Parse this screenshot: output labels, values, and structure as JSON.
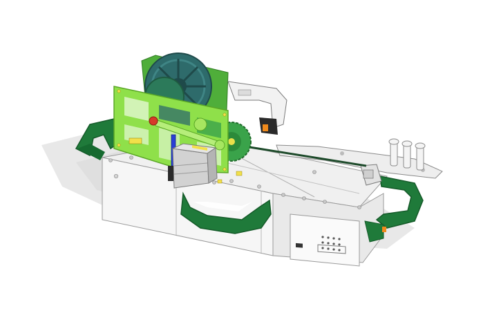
{
  "scene": {
    "subject": "3d-printed-machine-assembly",
    "colors": {
      "background": "#ffffff",
      "shadow": "#e4e4e4",
      "housing": "#f2f2f2",
      "housing_edge": "#9a9a9a",
      "handle": "#1f7a3a",
      "handle_dark": "#155a29",
      "frame_green": "#8fe04a",
      "frame_green_dark": "#5aa626",
      "gear_teal": "#2e6b6b",
      "gear_green": "#3aa34a",
      "motor": "#cfcfcf",
      "motor_dark": "#8a8a8a",
      "bracket": "#e8e8e8",
      "accent_orange": "#f08a1c",
      "accent_red": "#d63a2a",
      "accent_blue": "#2a3fd6",
      "accent_yellow": "#f2e04a",
      "rod": "#1d4a2a"
    }
  }
}
